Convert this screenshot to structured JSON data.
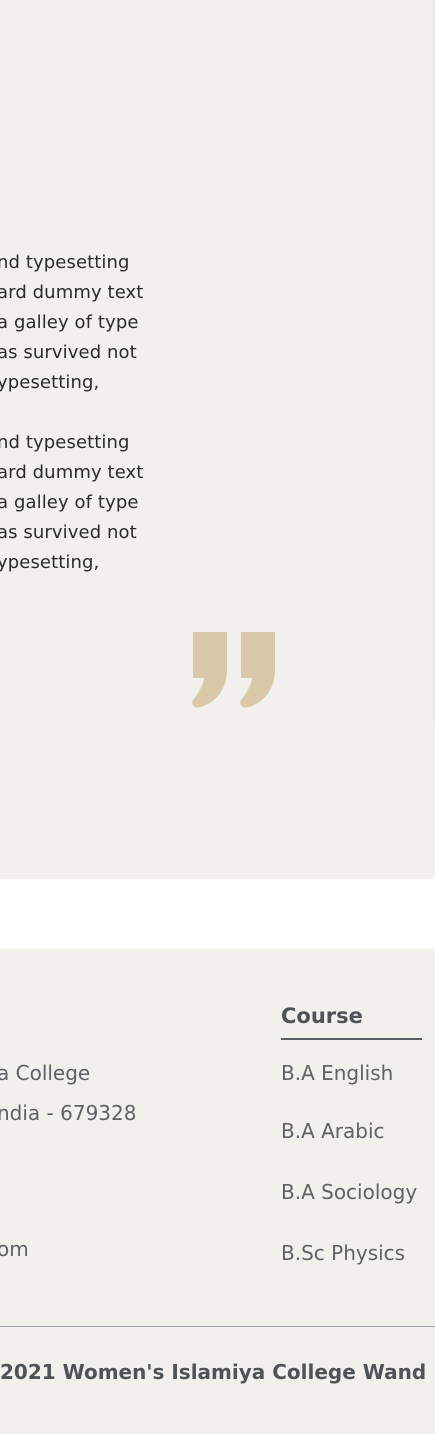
{
  "testimonial": {
    "paragraph_1": [
      "nd typesetting",
      "ard dummy text",
      "a galley of type",
      "as survived not",
      "ypesetting,"
    ],
    "paragraph_2": [
      "nd typesetting",
      "ard dummy text",
      "a galley of type",
      "as survived not",
      "ypesetting,"
    ],
    "quote_icon": "closing-quote-icon",
    "quote_color": "#d9c9a9"
  },
  "footer": {
    "address": {
      "line_1": "a College",
      "line_2": "ndia - 679328",
      "email_tail": "om"
    },
    "course": {
      "title": "Course",
      "items": [
        "B.A English",
        "B.A Arabic",
        "B.A Sociology",
        "B.Sc Physics"
      ]
    },
    "copyright": "2021 Women's Islamiya College Wand"
  },
  "colors": {
    "section_bg": "#f1f0ed",
    "text_dark": "#2b2b2b",
    "text_muted": "#5f6166",
    "heading": "#4f5257"
  }
}
